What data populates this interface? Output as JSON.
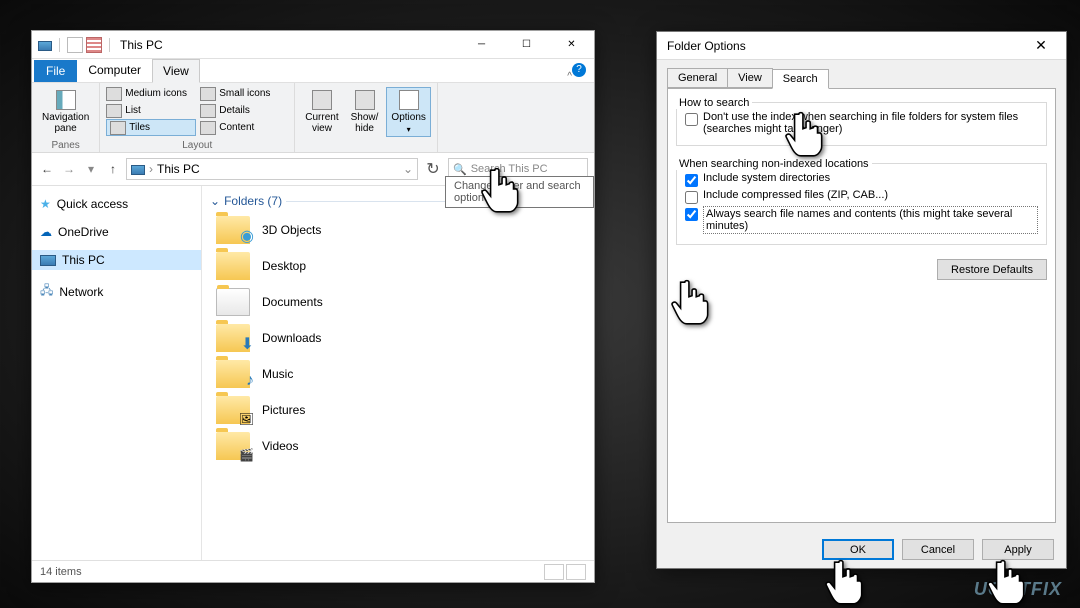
{
  "explorer": {
    "title": "This PC",
    "tabs": {
      "file": "File",
      "computer": "Computer",
      "view": "View"
    },
    "ribbon": {
      "panes_label": "Panes",
      "nav_pane": "Navigation\npane",
      "layout_label": "Layout",
      "layout_items": [
        "Medium icons",
        "Small icons",
        "List",
        "Details",
        "Tiles",
        "Content"
      ],
      "current_view": "Current\nview",
      "show_hide": "Show/\nhide",
      "options": "Options"
    },
    "tooltip": "Change folder and search options",
    "address": "This PC",
    "search_placeholder": "Search This PC",
    "sidebar": {
      "quick_access": "Quick access",
      "onedrive": "OneDrive",
      "this_pc": "This PC",
      "network": "Network"
    },
    "folders_header": "Folders (7)",
    "folders": [
      "3D Objects",
      "Desktop",
      "Documents",
      "Downloads",
      "Music",
      "Pictures",
      "Videos"
    ],
    "status": "14 items"
  },
  "dialog": {
    "title": "Folder Options",
    "tabs": {
      "general": "General",
      "view": "View",
      "search": "Search"
    },
    "howto_label": "How to search",
    "chk_index": "Don't use the index when searching in file folders for system files (searches might take longer)",
    "nonindexed_label": "When searching non-indexed locations",
    "chk_sysdir": "Include system directories",
    "chk_compressed": "Include compressed files (ZIP, CAB...)",
    "chk_always": "Always search file names and contents (this might take several minutes)",
    "restore": "Restore Defaults",
    "ok": "OK",
    "cancel": "Cancel",
    "apply": "Apply"
  },
  "watermark": "UG⊖TFIX"
}
